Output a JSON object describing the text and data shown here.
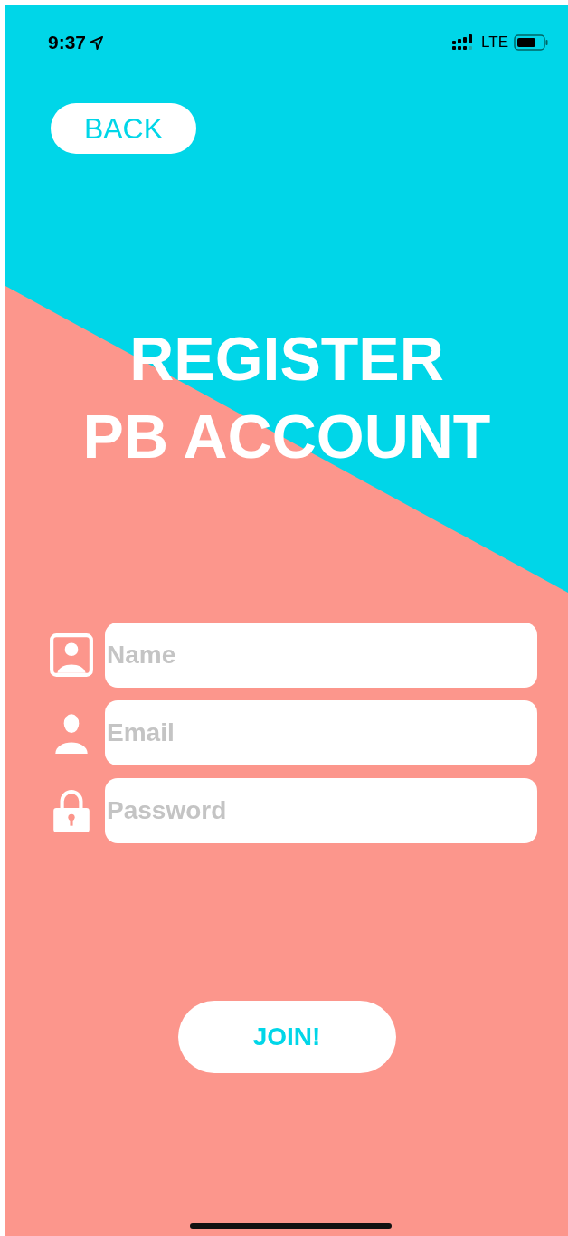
{
  "status_bar": {
    "time": "9:37",
    "network": "LTE"
  },
  "back_button": {
    "label": "BACK"
  },
  "title": [
    "REGISTER",
    "PB ACCOUNT"
  ],
  "fields": [
    {
      "placeholder": "Name"
    },
    {
      "placeholder": "Email"
    },
    {
      "placeholder": "Password"
    }
  ],
  "join_button": {
    "label": "JOIN!"
  }
}
